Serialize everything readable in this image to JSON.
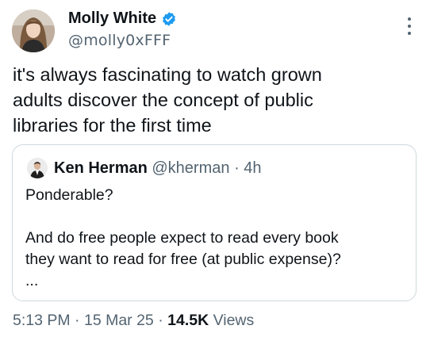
{
  "author": {
    "name": "Molly White",
    "handle": "@molly0xFFF",
    "verified": true
  },
  "tweet": {
    "text": "it's always fascinating to watch grown\nadults discover the concept of public\nlibraries for the first time"
  },
  "quote": {
    "name": "Ken Herman",
    "handle": "@kherman",
    "separator": "·",
    "time": "4h",
    "text": "Ponderable?\n\nAnd do free people expect to read every book\nthey want to read for free (at public expense)?\n..."
  },
  "footer": {
    "time": "5:13 PM",
    "separator": "·",
    "date": "15 Mar 25",
    "views_count": "14.5K",
    "views_label": "Views"
  },
  "colors": {
    "verified_badge": "#1d9bf0",
    "secondary_text": "#536471",
    "border": "#cfd9de"
  }
}
